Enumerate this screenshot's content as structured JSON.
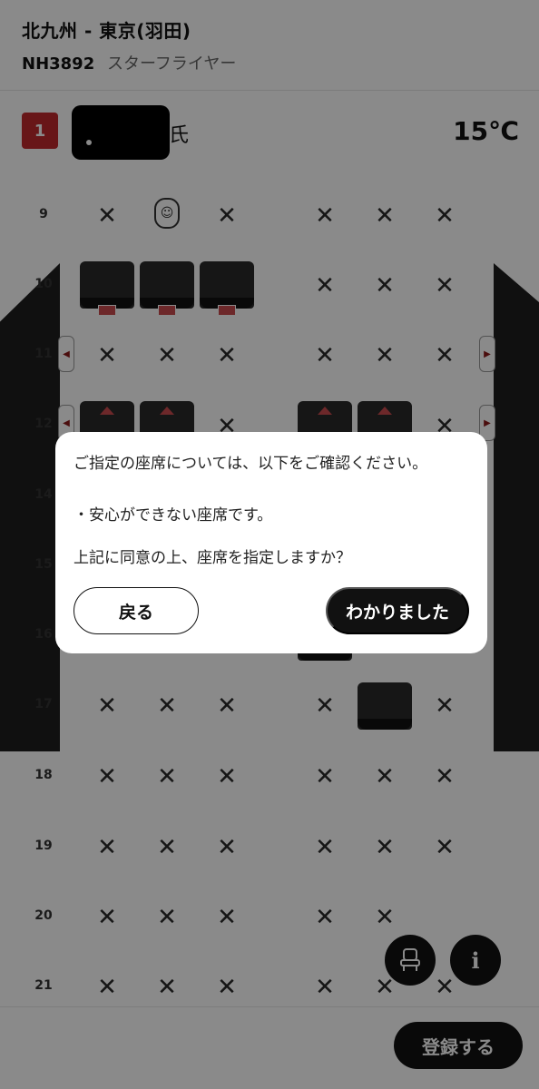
{
  "header": {
    "route": "北九州 - 東京(羽田)",
    "flight_number": "NH3892",
    "flight_name": "スターフライヤー"
  },
  "passenger": {
    "number": "1",
    "name_prefix": "",
    "name_suffix": "氏",
    "temperature": "15℃"
  },
  "seatmap": {
    "rows": [
      "9",
      "10",
      "11",
      "12",
      "14",
      "15",
      "16",
      "17",
      "18",
      "19",
      "20",
      "21"
    ],
    "unavailable_mark": "✕",
    "exit_left_glyph": "◀",
    "exit_right_glyph": "▶"
  },
  "dialog": {
    "message_line1": "ご指定の座席については、以下をご確認ください。",
    "message_line2": "・安心ができない座席です。",
    "message_line3": "上記に同意の上、座席を指定しますか？",
    "back_label": "戻る",
    "ok_label": "わかりました"
  },
  "footer": {
    "register_label": "登録する",
    "info_label": "i"
  },
  "colors": {
    "accent": "#c0292e",
    "primary": "#111111"
  },
  "icons": {
    "infant": "infant-bassinet-icon",
    "seat_fab": "seat-icon",
    "info_fab": "info-icon"
  }
}
